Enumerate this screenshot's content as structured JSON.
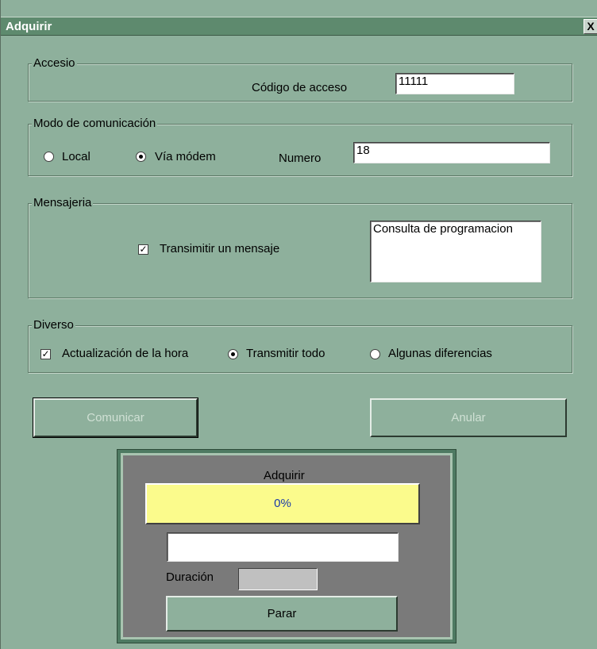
{
  "window": {
    "title": "Adquirir",
    "close_glyph": "X"
  },
  "acceso": {
    "legend": "Accesio",
    "code_label": "Código de acceso",
    "code_value": "11111"
  },
  "modo": {
    "legend": "Modo de comunicación",
    "local_label": "Local",
    "local_selected": false,
    "modem_label": "Vía módem",
    "modem_selected": true,
    "numero_label": "Numero",
    "numero_value": "18"
  },
  "mensajeria": {
    "legend": "Mensajeria",
    "transmit_label": "Transimitir un mensaje",
    "transmit_checked": true,
    "message_value": "Consulta de programacion"
  },
  "diverso": {
    "legend": "Diverso",
    "update_time_label": "Actualización de la hora",
    "update_time_checked": true,
    "transmit_all_label": "Transmitir todo",
    "transmit_all_selected": true,
    "some_diffs_label": "Algunas diferencias",
    "some_diffs_selected": false
  },
  "buttons": {
    "comunicar": "Comunicar",
    "anular": "Anular"
  },
  "progress_panel": {
    "title": "Adquirir",
    "percent_text": "0%",
    "progress_fraction": 0.0,
    "status_value": "",
    "duracion_label": "Duración",
    "duracion_value": "",
    "stop_label": "Parar"
  },
  "colors": {
    "window_bg": "#8eb09c",
    "titlebar": "#5e8a6e",
    "progress_fill": "#fbfb8c",
    "percent_text": "#1a3aa8"
  },
  "icons": {
    "check": "check-icon",
    "radio_dot": "radio-dot-icon",
    "close": "close-icon"
  }
}
